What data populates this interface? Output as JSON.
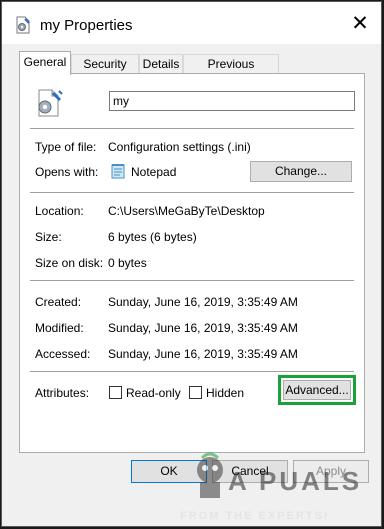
{
  "window": {
    "title": "my Properties",
    "close_glyph": "✕",
    "title_icon": "settings-file-icon"
  },
  "tabs": [
    {
      "label": "General",
      "active": true
    },
    {
      "label": "Security",
      "active": false
    },
    {
      "label": "Details",
      "active": false
    },
    {
      "label": "Previous Versions",
      "active": false
    }
  ],
  "general": {
    "file_name": "my",
    "type_label": "Type of file:",
    "type_value": "Configuration settings (.ini)",
    "opens_label": "Opens with:",
    "opens_value": "Notepad",
    "change_label": "Change...",
    "location_label": "Location:",
    "location_value": "C:\\Users\\MeGaByTe\\Desktop",
    "size_label": "Size:",
    "size_value": "6 bytes (6 bytes)",
    "size_disk_label": "Size on disk:",
    "size_disk_value": "0 bytes",
    "created_label": "Created:",
    "created_value": "Sunday, June 16, 2019, 3:35:49 AM",
    "modified_label": "Modified:",
    "modified_value": "Sunday, June 16, 2019, 3:35:49 AM",
    "accessed_label": "Accessed:",
    "accessed_value": "Sunday, June 16, 2019, 3:35:49 AM",
    "attributes_label": "Attributes:",
    "readonly_label": "Read-only",
    "hidden_label": "Hidden",
    "advanced_label": "Advanced...",
    "highlight_color": "#1aa138"
  },
  "footer": {
    "ok_label": "OK",
    "cancel_label": "Cancel",
    "apply_label": "Apply"
  },
  "watermark": {
    "brand": "A PUALS",
    "tagline": "FROM THE EXPERTS!"
  }
}
